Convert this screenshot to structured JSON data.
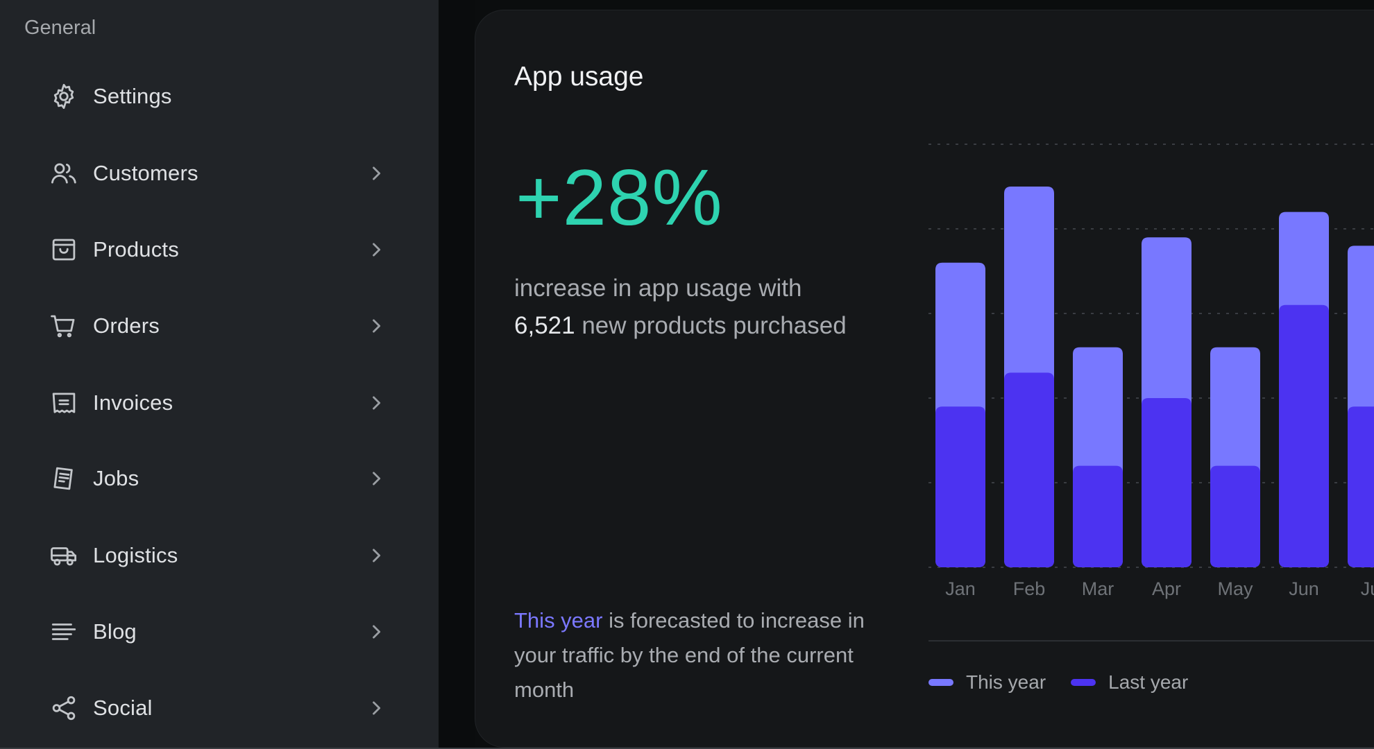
{
  "sidebar": {
    "section_label": "General",
    "items": [
      {
        "label": "Settings",
        "icon": "gear-icon",
        "has_chevron": false
      },
      {
        "label": "Customers",
        "icon": "users-icon",
        "has_chevron": true
      },
      {
        "label": "Products",
        "icon": "shopping-bag-icon",
        "has_chevron": true
      },
      {
        "label": "Orders",
        "icon": "cart-icon",
        "has_chevron": true
      },
      {
        "label": "Invoices",
        "icon": "receipt-icon",
        "has_chevron": true
      },
      {
        "label": "Jobs",
        "icon": "document-icon",
        "has_chevron": true
      },
      {
        "label": "Logistics",
        "icon": "truck-icon",
        "has_chevron": true
      },
      {
        "label": "Blog",
        "icon": "text-lines-icon",
        "has_chevron": true
      },
      {
        "label": "Social",
        "icon": "share-icon",
        "has_chevron": true
      }
    ]
  },
  "card": {
    "title": "App usage",
    "stat": "+28%",
    "stat_color": "#2ed3b0",
    "desc_line1": "increase in app usage with",
    "desc_number": "6,521",
    "desc_line2_rest": " new products purchased",
    "forecast_highlight": "This year",
    "forecast_rest": " is forecasted to increase in your traffic by the end of the current month"
  },
  "chart_data": {
    "type": "bar",
    "stacked": false,
    "overlapped": true,
    "categories": [
      "Jan",
      "Feb",
      "Mar",
      "Apr",
      "May",
      "Jun",
      "Jul"
    ],
    "series": [
      {
        "name": "This year",
        "color": "#7878ff",
        "values": [
          3.6,
          4.5,
          2.6,
          3.9,
          2.6,
          4.2,
          3.8
        ]
      },
      {
        "name": "Last year",
        "color": "#4c33f1",
        "values": [
          1.9,
          2.3,
          1.2,
          2.0,
          1.2,
          3.1,
          1.9
        ]
      }
    ],
    "ylim": [
      0,
      5
    ],
    "y_gridlines": [
      0,
      1,
      2,
      3,
      4,
      5
    ],
    "grid": true,
    "y_tick_labels_visible": false,
    "title": "",
    "xlabel": "",
    "ylabel": "",
    "legend_position": "bottom-left"
  }
}
